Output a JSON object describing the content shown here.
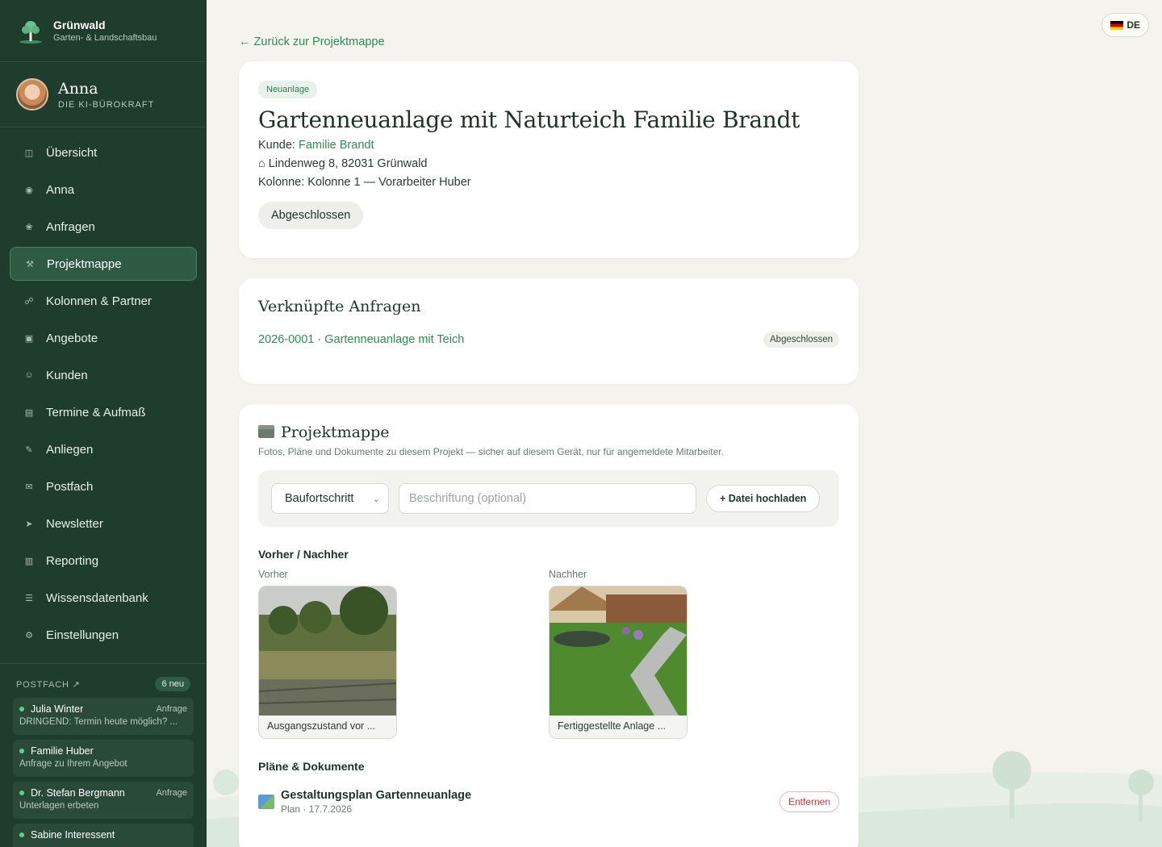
{
  "brand": {
    "name": "Grünwald",
    "subtitle": "Garten- & Landschaftsbau"
  },
  "assistant": {
    "name": "Anna",
    "role": "DIE KI-BÜROKRAFT"
  },
  "nav": [
    {
      "label": "Übersicht",
      "icon": "◫",
      "active": false
    },
    {
      "label": "Anna",
      "icon": "◉",
      "active": false
    },
    {
      "label": "Anfragen",
      "icon": "❀",
      "active": false
    },
    {
      "label": "Projektmappe",
      "icon": "⚒",
      "active": true
    },
    {
      "label": "Kolonnen & Partner",
      "icon": "☍",
      "active": false
    },
    {
      "label": "Angebote",
      "icon": "▣",
      "active": false
    },
    {
      "label": "Kunden",
      "icon": "☺",
      "active": false
    },
    {
      "label": "Termine & Aufmaß",
      "icon": "▤",
      "active": false
    },
    {
      "label": "Anliegen",
      "icon": "✎",
      "active": false
    },
    {
      "label": "Postfach",
      "icon": "✉",
      "active": false
    },
    {
      "label": "Newsletter",
      "icon": "➤",
      "active": false
    },
    {
      "label": "Reporting",
      "icon": "▥",
      "active": false
    },
    {
      "label": "Wissensdatenbank",
      "icon": "☰",
      "active": false
    },
    {
      "label": "Einstellungen",
      "icon": "⚙",
      "active": false
    }
  ],
  "inbox": {
    "title": "POSTFACH ↗",
    "count": "6 neu",
    "items": [
      {
        "name": "Julia Winter",
        "tag": "Anfrage",
        "preview": "DRINGEND: Termin heute möglich? ..."
      },
      {
        "name": "Familie Huber",
        "tag": "",
        "preview": "Anfrage zu Ihrem Angebot"
      },
      {
        "name": "Dr. Stefan Bergmann",
        "tag": "Anfrage",
        "preview": "Unterlagen erbeten"
      },
      {
        "name": "Sabine Interessent",
        "tag": "",
        "preview": ""
      }
    ]
  },
  "lang": {
    "label": "DE"
  },
  "back_link": "← Zurück zur Projektmappe",
  "project": {
    "badge": "Neuanlage",
    "title": "Gartenneuanlage mit Naturteich Familie Brandt",
    "customer_label": "Kunde:",
    "customer_name": "Familie Brandt",
    "address": "⌂ Lindenweg 8, 82031 Grünwald",
    "crew": "Kolonne: Kolonne 1 — Vorarbeiter Huber",
    "status": "Abgeschlossen"
  },
  "linked": {
    "title": "Verknüpfte Anfragen",
    "items": [
      {
        "label": "2026-0001 · Gartenneuanlage mit Teich",
        "status": "Abgeschlossen"
      }
    ]
  },
  "folder": {
    "title": "Projektmappe",
    "description": "Fotos, Pläne und Dokumente zu diesem Projekt — sicher auf diesem Gerät, nur für angemeldete Mitarbeiter.",
    "category": "Baufortschritt",
    "caption_placeholder": "Beschriftung (optional)",
    "upload_label": "+ Datei hochladen",
    "before_after_title": "Vorher / Nachher",
    "before": {
      "label": "Vorher",
      "caption": "Ausgangszustand vor ..."
    },
    "after": {
      "label": "Nachher",
      "caption": "Fertiggestellte Anlage ..."
    },
    "docs_title": "Pläne & Dokumente",
    "docs": [
      {
        "name": "Gestaltungsplan Gartenneuanlage",
        "meta": "Plan · 17.7.2026",
        "action": "Entfernen"
      }
    ]
  }
}
